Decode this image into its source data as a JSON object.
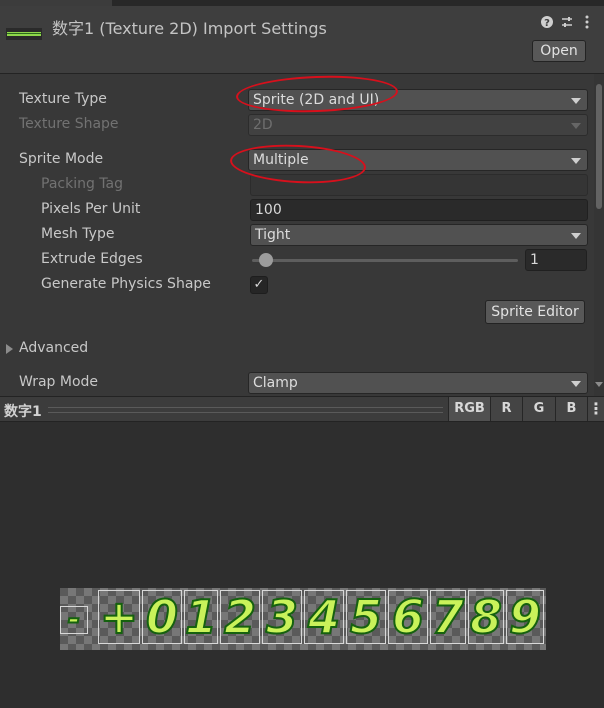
{
  "header": {
    "title": "数字1 (Texture 2D) Import Settings",
    "open_label": "Open",
    "icons": [
      "help-icon",
      "preset-icon",
      "more-icon"
    ]
  },
  "settings": {
    "texture_type": {
      "label": "Texture Type",
      "value": "Sprite (2D and UI)"
    },
    "texture_shape": {
      "label": "Texture Shape",
      "value": "2D"
    },
    "sprite_mode": {
      "label": "Sprite Mode",
      "value": "Multiple"
    },
    "packing_tag": {
      "label": "Packing Tag",
      "value": ""
    },
    "pixels_per_unit": {
      "label": "Pixels Per Unit",
      "value": "100"
    },
    "mesh_type": {
      "label": "Mesh Type",
      "value": "Tight"
    },
    "extrude_edges": {
      "label": "Extrude Edges",
      "value": "1",
      "slider_fraction": 0.03
    },
    "generate_physics_shape": {
      "label": "Generate Physics Shape",
      "checked": true,
      "check_glyph": "✓"
    },
    "sprite_editor_label": "Sprite Editor",
    "advanced_label": "Advanced",
    "wrap_mode": {
      "label": "Wrap Mode",
      "value": "Clamp"
    }
  },
  "preview": {
    "title": "数字1",
    "channels": [
      "RGB",
      "R",
      "G",
      "B"
    ],
    "more_glyph": "⋮",
    "glyphs": [
      "-",
      "+",
      "0",
      "1",
      "2",
      "3",
      "4",
      "5",
      "6",
      "7",
      "8",
      "9"
    ]
  },
  "colors": {
    "annotation": "#d7101c",
    "glyph_fill": "#c9f25a",
    "glyph_outline": "#15610f"
  }
}
